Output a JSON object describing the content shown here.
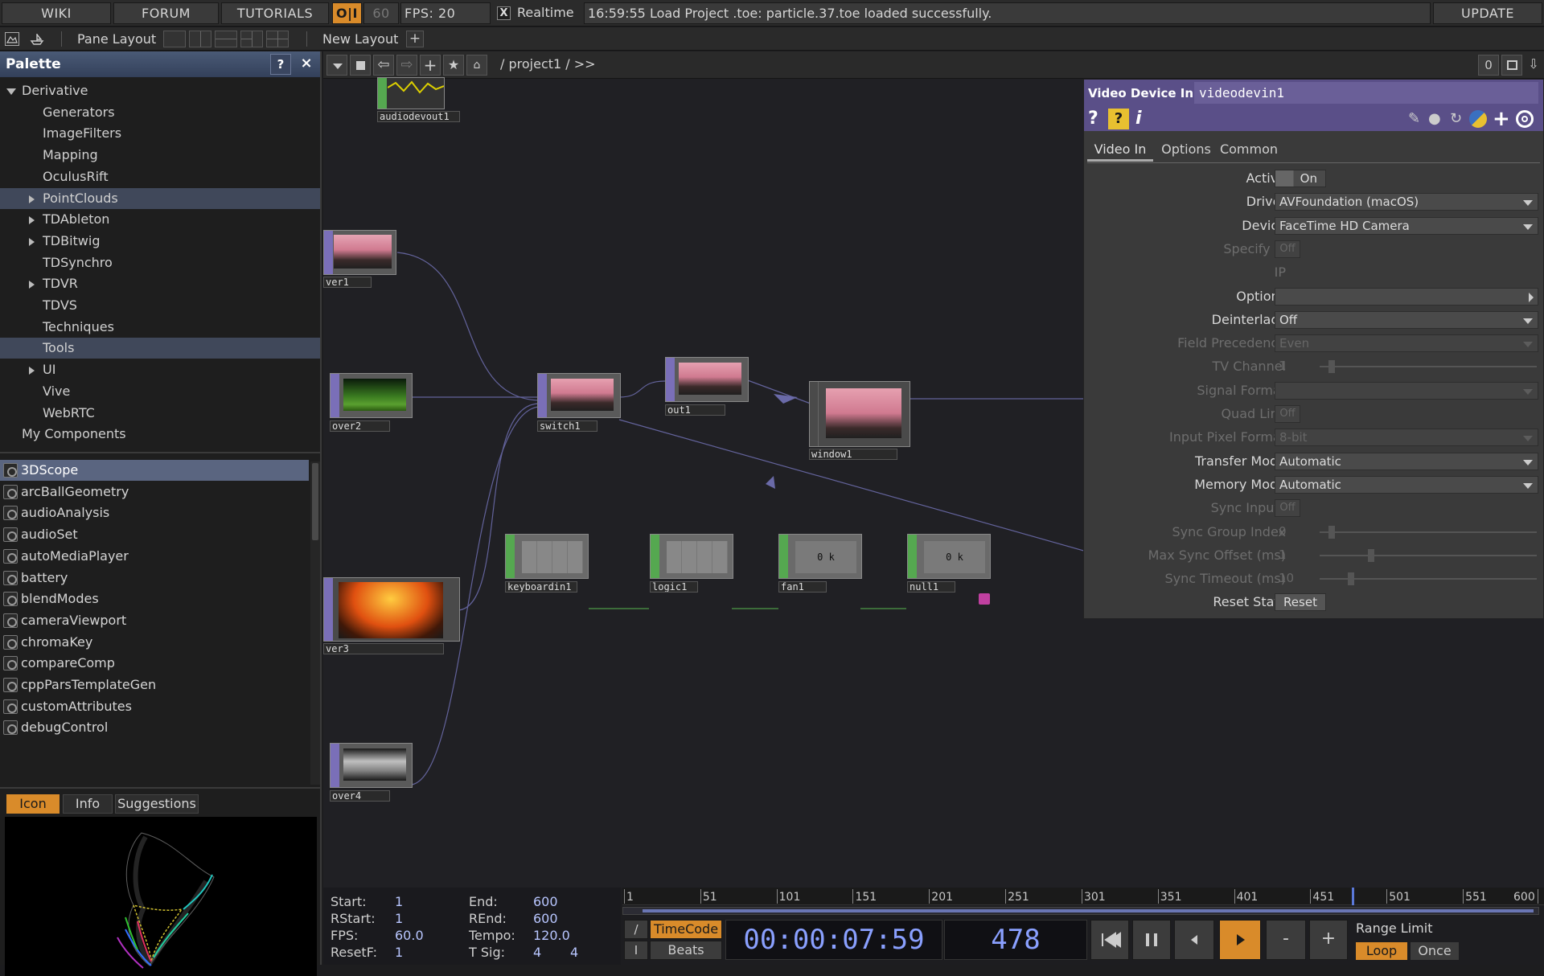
{
  "topbar": {
    "wiki": "WIKI",
    "forum": "FORUM",
    "tutorials": "TUTORIALS",
    "oi": "O|I",
    "fps_cap": "60",
    "fps_label": "FPS:",
    "fps_value": "20",
    "realtime_check": "X",
    "realtime": "Realtime",
    "status": "16:59:55 Load Project .toe: particle.37.toe loaded successfully.",
    "update": "UPDATE"
  },
  "toolbar": {
    "pane_layout": "Pane Layout",
    "new_layout": "New Layout",
    "plus": "+"
  },
  "palette": {
    "title": "Palette",
    "help": "?",
    "close": "×",
    "tree": [
      {
        "label": "Derivative",
        "indent": 0,
        "arrow": "down"
      },
      {
        "label": "Generators",
        "indent": 2
      },
      {
        "label": "ImageFilters",
        "indent": 2
      },
      {
        "label": "Mapping",
        "indent": 2
      },
      {
        "label": "OculusRift",
        "indent": 2
      },
      {
        "label": "PointClouds",
        "indent": 2,
        "arrow": "right",
        "selected": true
      },
      {
        "label": "TDAbleton",
        "indent": 2,
        "arrow": "right"
      },
      {
        "label": "TDBitwig",
        "indent": 2,
        "arrow": "right"
      },
      {
        "label": "TDSynchro",
        "indent": 2
      },
      {
        "label": "TDVR",
        "indent": 2,
        "arrow": "right"
      },
      {
        "label": "TDVS",
        "indent": 2
      },
      {
        "label": "Techniques",
        "indent": 2
      },
      {
        "label": "Tools",
        "indent": 2,
        "selected": true
      },
      {
        "label": "UI",
        "indent": 2,
        "arrow": "right"
      },
      {
        "label": "Vive",
        "indent": 2
      },
      {
        "label": "WebRTC",
        "indent": 2
      },
      {
        "label": "My Components",
        "indent": 1
      }
    ],
    "components": [
      {
        "label": "3DScope",
        "selected": true
      },
      {
        "label": "arcBallGeometry"
      },
      {
        "label": "audioAnalysis"
      },
      {
        "label": "audioSet"
      },
      {
        "label": "autoMediaPlayer"
      },
      {
        "label": "battery"
      },
      {
        "label": "blendModes"
      },
      {
        "label": "cameraViewport"
      },
      {
        "label": "chromaKey"
      },
      {
        "label": "compareComp"
      },
      {
        "label": "cppParsTemplateGen"
      },
      {
        "label": "customAttributes"
      },
      {
        "label": "debugControl"
      }
    ],
    "tabs": {
      "icon": "Icon",
      "info": "Info",
      "suggestions": "Suggestions"
    }
  },
  "network": {
    "path": "/ project1 / >>",
    "counter": "0",
    "nodes": {
      "audiodevout1": "audiodevout1",
      "over1": "ver1",
      "over2": "over2",
      "switch1": "switch1",
      "out1": "out1",
      "window1": "window1",
      "over3": "ver3",
      "over4": "over4",
      "keyboardin1": "keyboardin1",
      "logic1": "logic1",
      "fan1": "fan1",
      "null1": "null1",
      "fan_val": "0 k",
      "null_val": "0 k"
    }
  },
  "params": {
    "op_type": "Video Device In",
    "op_name": "videodevin1",
    "tabs": {
      "video_in": "Video In",
      "options": "Options",
      "common": "Common"
    },
    "rows": [
      {
        "label": "Active",
        "type": "toggle",
        "value": "On"
      },
      {
        "label": "Driver",
        "type": "menu",
        "value": "AVFoundation (macOS)"
      },
      {
        "label": "Device",
        "type": "menu",
        "value": "FaceTime HD Camera"
      },
      {
        "label": "Specify IP",
        "type": "toggle",
        "value": "Off",
        "disabled": true
      },
      {
        "label": "IP",
        "type": "blank",
        "value": "",
        "disabled": true
      },
      {
        "label": "Options",
        "type": "arrow",
        "value": ""
      },
      {
        "label": "Deinterlace",
        "type": "menu",
        "value": "Off"
      },
      {
        "label": "Field Precedence",
        "type": "menu",
        "value": "Even",
        "disabled": true
      },
      {
        "label": "TV Channel",
        "type": "slider",
        "value": "1",
        "disabled": true
      },
      {
        "label": "Signal Format",
        "type": "menu",
        "value": "",
        "disabled": true
      },
      {
        "label": "Quad Link",
        "type": "toggle",
        "value": "Off",
        "disabled": true
      },
      {
        "label": "Input Pixel Format",
        "type": "menu",
        "value": "8-bit",
        "disabled": true
      },
      {
        "label": "Transfer Mode",
        "type": "menu",
        "value": "Automatic"
      },
      {
        "label": "Memory Mode",
        "type": "menu",
        "value": "Automatic"
      },
      {
        "label": "Sync Inputs",
        "type": "toggle",
        "value": "Off",
        "disabled": true
      },
      {
        "label": "Sync Group Index",
        "type": "slider",
        "value": "0",
        "disabled": true
      },
      {
        "label": "Max Sync Offset (ms)",
        "type": "slider",
        "value": "1",
        "disabled": true
      },
      {
        "label": "Sync Timeout (ms)",
        "type": "slider",
        "value": "10",
        "disabled": true
      },
      {
        "label": "Reset Stats",
        "type": "button",
        "value": "Reset"
      }
    ]
  },
  "timeline": {
    "start_l": "Start:",
    "start": "1",
    "rstart_l": "RStart:",
    "rstart": "1",
    "fps_l": "FPS:",
    "fps": "60.0",
    "resetf_l": "ResetF:",
    "resetf": "1",
    "end_l": "End:",
    "end": "600",
    "rend_l": "REnd:",
    "rend": "600",
    "tempo_l": "Tempo:",
    "tempo": "120.0",
    "tsig_l": "T Sig:",
    "tsig_a": "4",
    "tsig_b": "4",
    "ruler": [
      "1",
      "51",
      "101",
      "151",
      "201",
      "251",
      "301",
      "351",
      "401",
      "451",
      "501",
      "551",
      "600"
    ],
    "timecode": "TimeCode",
    "beats": "Beats",
    "slash": "/",
    "ibar": "I",
    "time": "00:00:07:59",
    "frame": "478",
    "range_limit": "Range Limit",
    "loop": "Loop",
    "once": "Once",
    "minus": "-",
    "plus": "+",
    "current_frame": 478,
    "frame_min": 1,
    "frame_max": 600
  }
}
